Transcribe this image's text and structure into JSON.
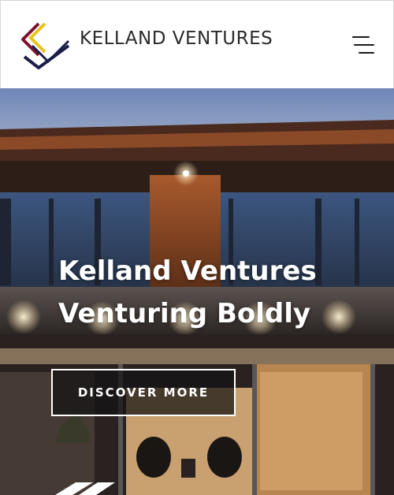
{
  "header": {
    "logo_text": "KELLAND VENTURES",
    "logo_colors": [
      "#7a1430",
      "#e8c31a",
      "#1b1d4a"
    ],
    "menu_icon": "hamburger-menu-icon"
  },
  "hero": {
    "title_line1": "Kelland Ventures",
    "title_line2": "Venturing Boldly",
    "cta_label": "DISCOVER MORE"
  }
}
